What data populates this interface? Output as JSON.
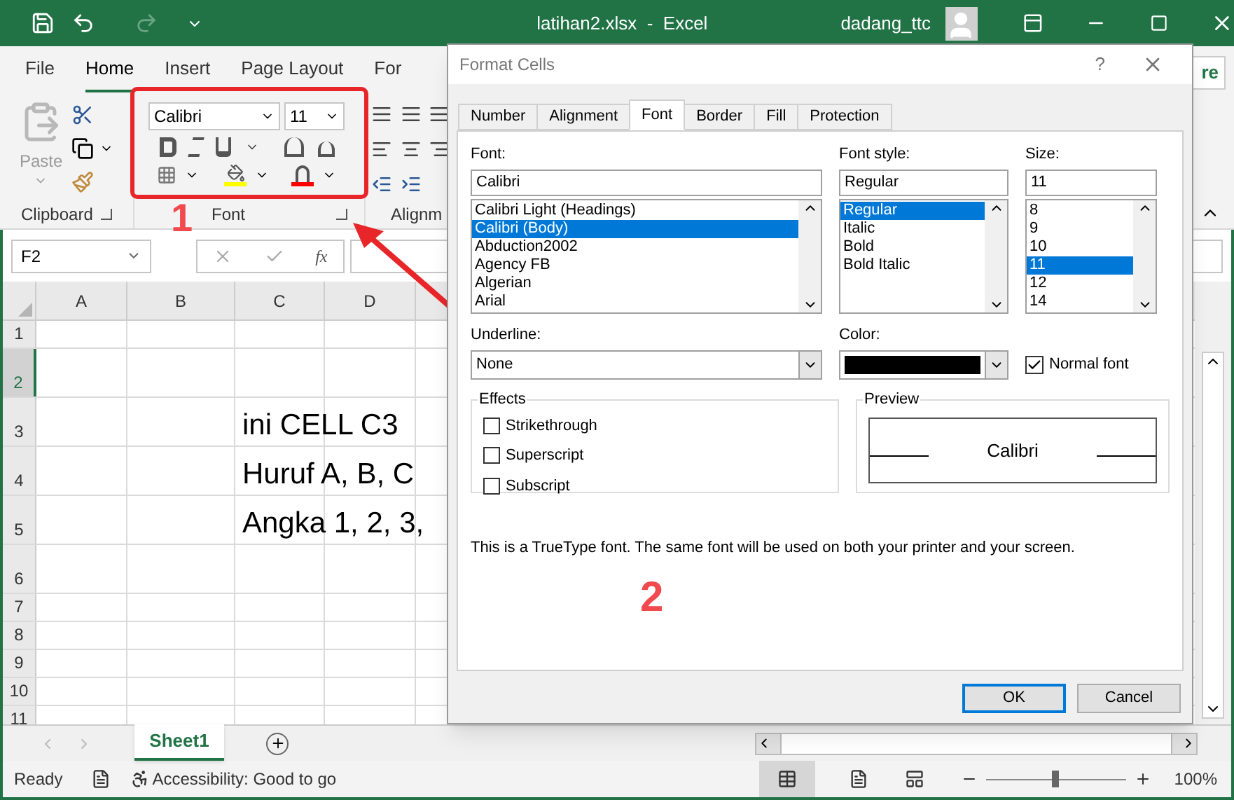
{
  "title_bar": {
    "title": "latihan2.xlsx  -  Excel",
    "user": "dadang_ttc"
  },
  "ribbon": {
    "tabs": [
      {
        "label": "File",
        "selected": false
      },
      {
        "label": "Home",
        "selected": true
      },
      {
        "label": "Insert",
        "selected": false
      },
      {
        "label": "Page Layout",
        "selected": false
      },
      {
        "label": "For",
        "selected": false
      }
    ],
    "share_button": "re",
    "paste_label": "Paste",
    "font_name": "Calibri",
    "font_size": "11",
    "groups": [
      "Clipboard",
      "Font",
      "Alignm"
    ]
  },
  "formula_bar": {
    "name_box": "F2",
    "insert_function": "fx"
  },
  "sheet": {
    "columns": [
      "A",
      "B",
      "C",
      "D"
    ],
    "rows": [
      {
        "number": "1",
        "selected": false
      },
      {
        "number": "2",
        "selected": true
      },
      {
        "number": "3",
        "selected": false,
        "column_c": "ini CELL C3"
      },
      {
        "number": "4",
        "selected": false,
        "column_c": "Huruf A, B, C"
      },
      {
        "number": "5",
        "selected": false,
        "column_c": "Angka 1, 2, 3,"
      },
      {
        "number": "6",
        "selected": false
      },
      {
        "number": "7",
        "selected": false
      },
      {
        "number": "8",
        "selected": false
      },
      {
        "number": "9",
        "selected": false
      },
      {
        "number": "10",
        "selected": false
      },
      {
        "number": "11",
        "selected": false
      }
    ],
    "sheet_tabs": [
      {
        "label": "Sheet1",
        "selected": true
      }
    ]
  },
  "status_bar": {
    "mode": "Ready",
    "accessibility": "Accessibility: Good to go",
    "zoom": "100%"
  },
  "dialog": {
    "title": "Format Cells",
    "help": "?",
    "tabs": [
      {
        "label": "Number",
        "selected": false
      },
      {
        "label": "Alignment",
        "selected": false
      },
      {
        "label": "Font",
        "selected": true
      },
      {
        "label": "Border",
        "selected": false
      },
      {
        "label": "Fill",
        "selected": false
      },
      {
        "label": "Protection",
        "selected": false
      }
    ],
    "font": {
      "label": "Font:",
      "value": "Calibri",
      "items": [
        {
          "label": "Calibri Light (Headings)",
          "selected": false
        },
        {
          "label": "Calibri (Body)",
          "selected": true
        },
        {
          "label": "Abduction2002",
          "selected": false
        },
        {
          "label": "Agency FB",
          "selected": false
        },
        {
          "label": "Algerian",
          "selected": false
        },
        {
          "label": "Arial",
          "selected": false
        }
      ]
    },
    "font_style": {
      "label": "Font style:",
      "value": "Regular",
      "items": [
        {
          "label": "Regular",
          "selected": true
        },
        {
          "label": "Italic",
          "selected": false
        },
        {
          "label": "Bold",
          "selected": false
        },
        {
          "label": "Bold Italic",
          "selected": false
        }
      ]
    },
    "size": {
      "label": "Size:",
      "value": "11",
      "items": [
        {
          "label": "8",
          "selected": false
        },
        {
          "label": "9",
          "selected": false
        },
        {
          "label": "10",
          "selected": false
        },
        {
          "label": "11",
          "selected": true
        },
        {
          "label": "12",
          "selected": false
        },
        {
          "label": "14",
          "selected": false
        }
      ]
    },
    "underline": {
      "label": "Underline:",
      "value": "None"
    },
    "color": {
      "label": "Color:",
      "color": "#000000"
    },
    "normal_font": {
      "label": "Normal font",
      "checked": true
    },
    "effects": {
      "legend": "Effects",
      "items": [
        {
          "label": "Strikethrough",
          "checked": false
        },
        {
          "label": "Superscript",
          "checked": false
        },
        {
          "label": "Subscript",
          "checked": false
        }
      ]
    },
    "preview": {
      "legend": "Preview",
      "text": "Calibri"
    },
    "note": "This is a TrueType font.  The same font will be used on both your printer and your screen.",
    "buttons": [
      "OK",
      "Cancel"
    ]
  },
  "annotations": [
    {
      "label": "1"
    },
    {
      "label": "2"
    }
  ]
}
